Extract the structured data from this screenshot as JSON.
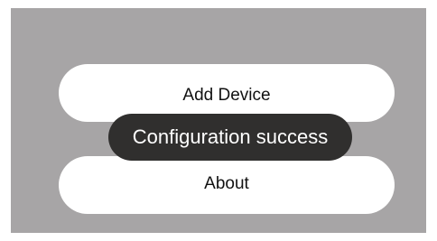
{
  "menu": {
    "add_device_label": "Add Device",
    "about_label": "About"
  },
  "toast": {
    "message": "Configuration success"
  },
  "colors": {
    "screen_background": "#a7a5a6",
    "button_background": "#ffffff",
    "toast_background": "#302f2e",
    "toast_text": "#ffffff"
  }
}
